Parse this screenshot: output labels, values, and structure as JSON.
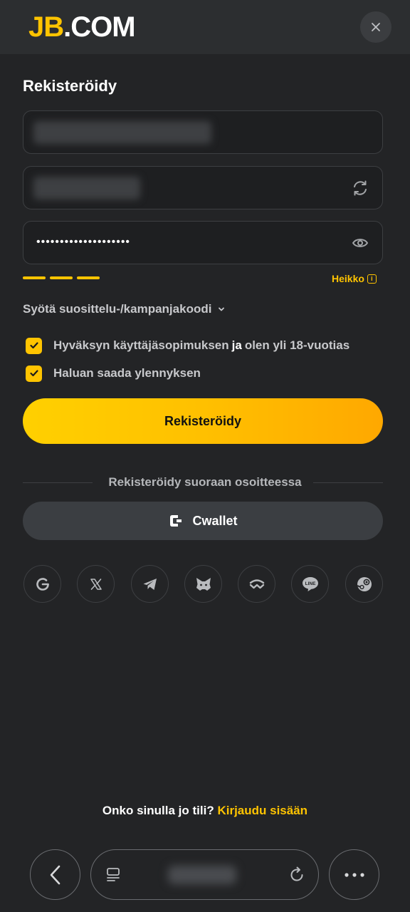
{
  "header": {
    "logo_primary": "JB",
    "logo_secondary": ".COM",
    "close_icon": "close-icon"
  },
  "form": {
    "title": "Rekisteröidy",
    "username_field": {
      "value": "",
      "note": "blurred"
    },
    "captcha_field": {
      "value": "",
      "icon": "refresh-icon"
    },
    "password_field": {
      "value": "••••••••••••••••••••",
      "icon": "eye-icon"
    },
    "strength": {
      "segments_filled": 3,
      "label": "Heikko",
      "icon": "info-icon"
    },
    "promo_label": "Syötä suosittelu-/kampanjakoodi",
    "terms": {
      "before": "Hyväksyn käyttäjäsopimuksen",
      "em": "ja",
      "after": "olen yli 18-vuotias",
      "checked": true
    },
    "promotions": {
      "label": "Haluan saada ylennyksen",
      "checked": true
    },
    "submit_label": "Rekisteröidy"
  },
  "alt": {
    "divider_label": "Rekisteröidy suoraan osoitteessa",
    "cwallet_label": "Cwallet",
    "socials": [
      "google-icon",
      "x-icon",
      "telegram-icon",
      "metamask-icon",
      "walletconnect-icon",
      "line-icon",
      "steam-icon"
    ]
  },
  "footer": {
    "question": "Onko sinulla jo tili?",
    "login_link": "Kirjaudu sisään"
  },
  "colors": {
    "accent": "#ffc400",
    "background": "#232426",
    "topbar": "#2c2e30"
  }
}
